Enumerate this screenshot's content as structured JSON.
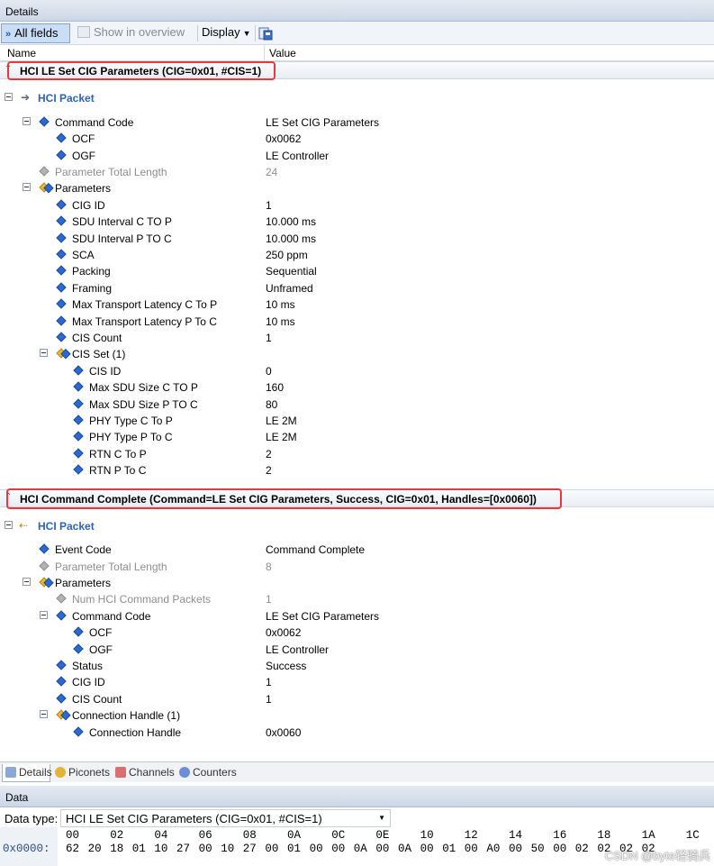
{
  "panel_title": "Details",
  "toolbar": {
    "all_fields": "All fields",
    "show_in_overview": "Show in overview",
    "display": "Display"
  },
  "columns": {
    "name": "Name",
    "value": "Value"
  },
  "frame1": {
    "header": "HCI LE Set CIG Parameters (CIG=0x01, #CIS=1)",
    "packet_label": "HCI Packet",
    "rows": [
      {
        "label": "Command Code",
        "value": "LE Set CIG Parameters"
      },
      {
        "label": "OCF",
        "value": "0x0062"
      },
      {
        "label": "OGF",
        "value": "LE Controller"
      },
      {
        "label": "Parameter Total Length",
        "value": "24"
      },
      {
        "label": "Parameters",
        "value": ""
      },
      {
        "label": "CIG ID",
        "value": "1"
      },
      {
        "label": "SDU Interval C TO P",
        "value": "10.000 ms"
      },
      {
        "label": "SDU Interval P TO C",
        "value": "10.000 ms"
      },
      {
        "label": "SCA",
        "value": "250 ppm"
      },
      {
        "label": "Packing",
        "value": "Sequential"
      },
      {
        "label": "Framing",
        "value": "Unframed"
      },
      {
        "label": "Max Transport Latency C To P",
        "value": "10 ms"
      },
      {
        "label": "Max Transport Latency P To C",
        "value": "10 ms"
      },
      {
        "label": "CIS Count",
        "value": "1"
      },
      {
        "label": "CIS Set (1)",
        "value": ""
      },
      {
        "label": "CIS ID",
        "value": "0"
      },
      {
        "label": "Max SDU Size C TO P",
        "value": "160"
      },
      {
        "label": "Max SDU Size P TO C",
        "value": "80"
      },
      {
        "label": "PHY Type C To P",
        "value": "LE 2M"
      },
      {
        "label": "PHY Type P To C",
        "value": "LE 2M"
      },
      {
        "label": "RTN C To P",
        "value": "2"
      },
      {
        "label": "RTN P To C",
        "value": "2"
      }
    ]
  },
  "frame2": {
    "header": "HCI Command Complete (Command=LE Set CIG Parameters, Success, CIG=0x01, Handles=[0x0060])",
    "packet_label": "HCI Packet",
    "rows": [
      {
        "label": "Event Code",
        "value": "Command Complete"
      },
      {
        "label": "Parameter Total Length",
        "value": "8"
      },
      {
        "label": "Parameters",
        "value": ""
      },
      {
        "label": "Num HCI Command Packets",
        "value": "1"
      },
      {
        "label": "Command Code",
        "value": "LE Set CIG Parameters"
      },
      {
        "label": "OCF",
        "value": "0x0062"
      },
      {
        "label": "OGF",
        "value": "LE Controller"
      },
      {
        "label": "Status",
        "value": "Success"
      },
      {
        "label": "CIG ID",
        "value": "1"
      },
      {
        "label": "CIS Count",
        "value": "1"
      },
      {
        "label": "Connection Handle (1)",
        "value": ""
      },
      {
        "label": "Connection Handle",
        "value": "0x0060"
      }
    ]
  },
  "tabs": [
    "Details",
    "Piconets",
    "Channels",
    "Counters"
  ],
  "data_panel": {
    "title": "Data",
    "data_type_label": "Data type:",
    "data_type_value": "HCI LE Set CIG Parameters (CIG=0x01, #CIS=1)",
    "hex_header": [
      "00",
      "02",
      "04",
      "06",
      "08",
      "0A",
      "0C",
      "0E",
      "10",
      "12",
      "14",
      "16",
      "18",
      "1A",
      "1C"
    ],
    "offset": "0x0000:",
    "bytes": [
      "62",
      "20",
      "18",
      "01",
      "10",
      "27",
      "00",
      "10",
      "27",
      "00",
      "01",
      "00",
      "00",
      "0A",
      "00",
      "0A",
      "00",
      "01",
      "00",
      "A0",
      "00",
      "50",
      "00",
      "02",
      "02",
      "02",
      "02"
    ]
  },
  "watermark": "CSDN @byte轻骑兵"
}
